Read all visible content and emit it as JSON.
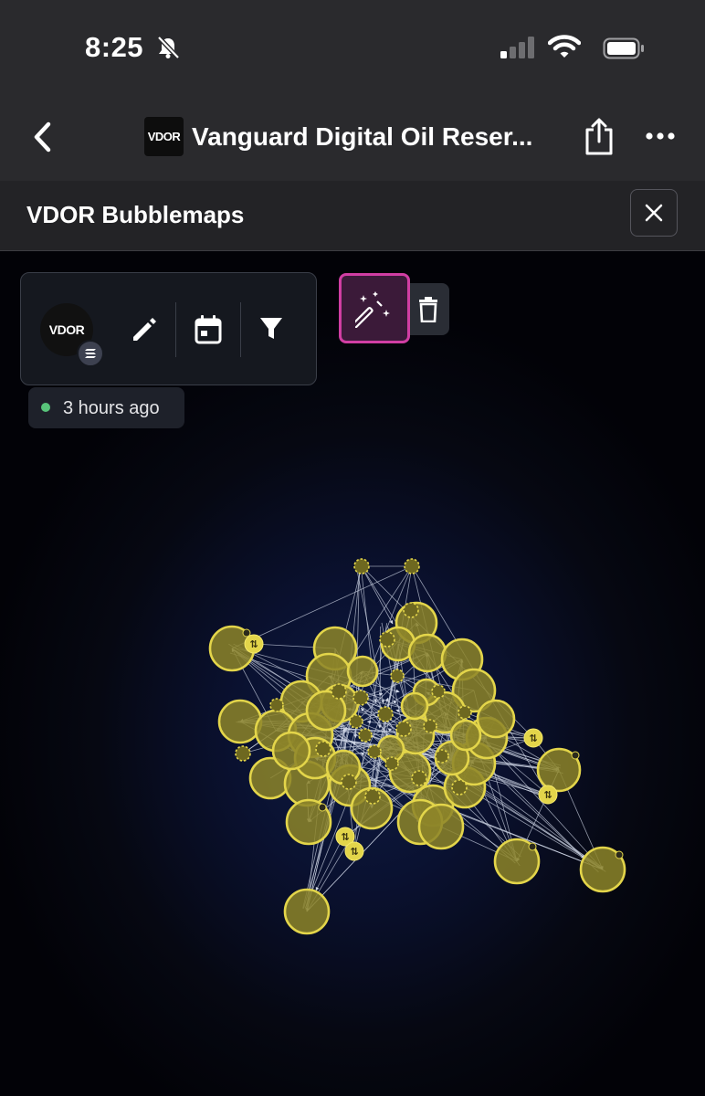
{
  "status_bar": {
    "time": "8:25"
  },
  "nav": {
    "title": "Vanguard Digital Oil Reser...",
    "token_logo_text": "VDOR"
  },
  "panel": {
    "title": "VDOR Bubblemaps",
    "avatar_text": "VDOR",
    "timestamp": "3 hours ago"
  },
  "icons": {
    "back": "chevron-left",
    "share": "share-square-arrow",
    "more": "ellipsis",
    "close": "x",
    "edit": "pencil",
    "calendar": "calendar",
    "filter": "funnel",
    "magic": "magic-wand",
    "trash": "trash-can",
    "chain": "solana"
  },
  "colors": {
    "bubble_fill": "#8d8529",
    "bubble_stroke": "#e3d54a",
    "magic_border": "#d13ea3",
    "live_dot": "#58c47a"
  }
}
